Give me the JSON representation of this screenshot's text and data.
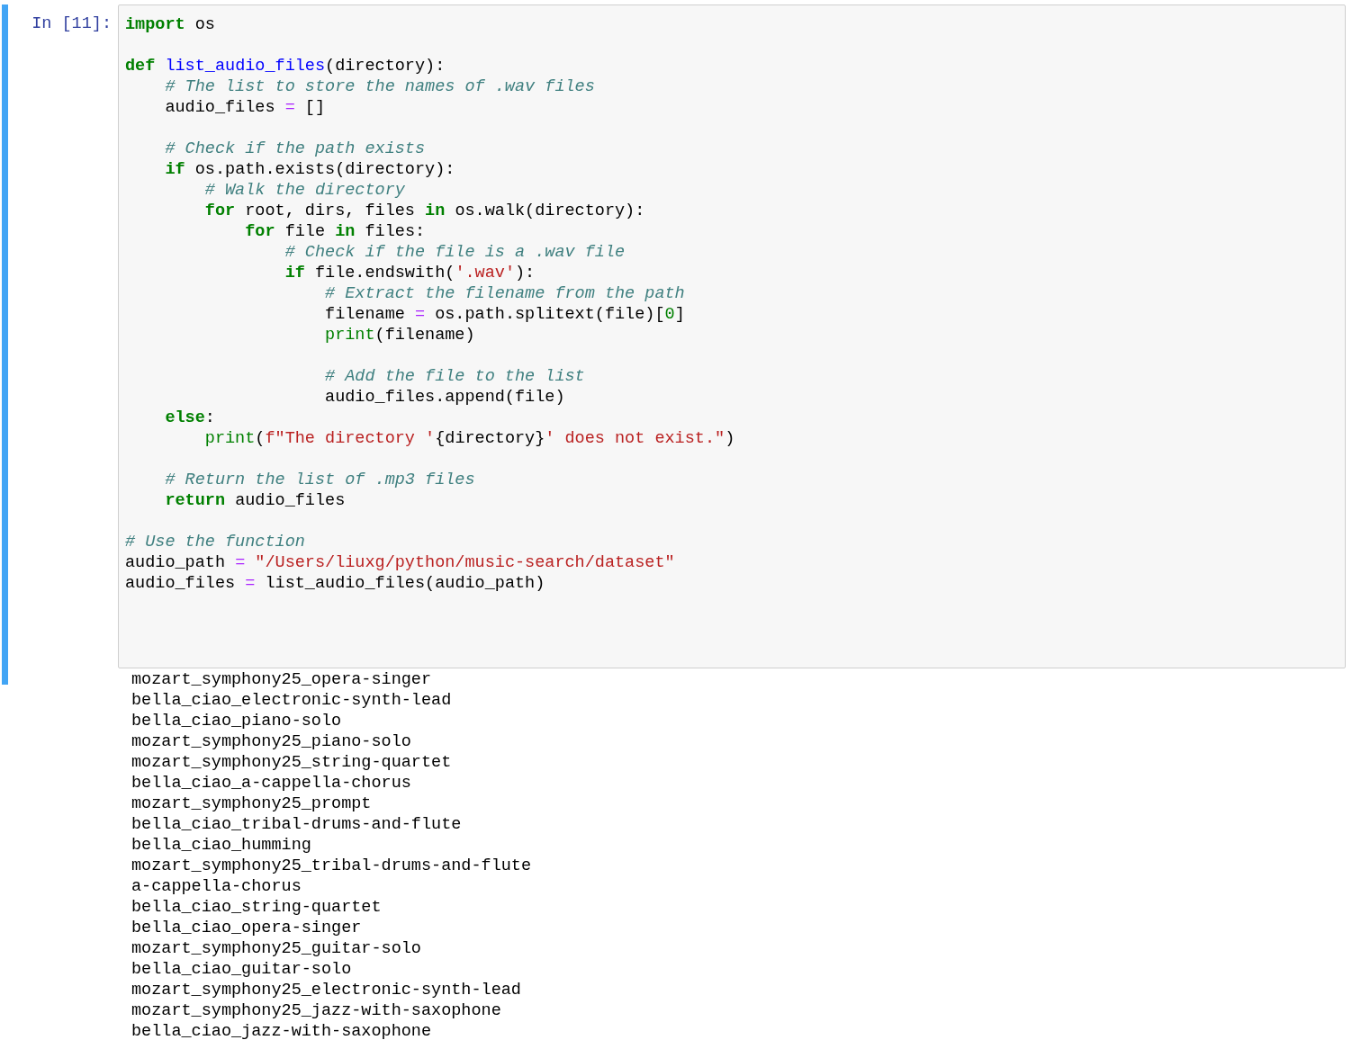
{
  "cell": {
    "prompt": "In [11]:",
    "selected": true,
    "lines": [
      {
        "kind": "code",
        "tokens": [
          {
            "kind": "keyword",
            "text": "import"
          },
          {
            "kind": "plain",
            "text": " os"
          }
        ]
      },
      {
        "kind": "blank"
      },
      {
        "kind": "code",
        "tokens": [
          {
            "kind": "keyword",
            "text": "def"
          },
          {
            "kind": "name",
            "text": " list_audio_files"
          },
          {
            "kind": "plain",
            "text": "(directory):"
          }
        ]
      },
      {
        "kind": "code",
        "tokens": [
          {
            "kind": "comment",
            "text": "    # The list to store the names of .wav files"
          }
        ]
      },
      {
        "kind": "code",
        "tokens": [
          {
            "kind": "plain",
            "text": "    audio_files "
          },
          {
            "kind": "operator",
            "text": "="
          },
          {
            "kind": "plain",
            "text": " []"
          }
        ]
      },
      {
        "kind": "blank"
      },
      {
        "kind": "code",
        "tokens": [
          {
            "kind": "comment",
            "text": "    # Check if the path exists"
          }
        ]
      },
      {
        "kind": "code",
        "tokens": [
          {
            "kind": "keyword",
            "text": "    if"
          },
          {
            "kind": "plain",
            "text": " os.path.exists(directory):"
          }
        ]
      },
      {
        "kind": "code",
        "tokens": [
          {
            "kind": "comment",
            "text": "        # Walk the directory"
          }
        ]
      },
      {
        "kind": "code",
        "tokens": [
          {
            "kind": "keyword",
            "text": "        for"
          },
          {
            "kind": "plain",
            "text": " root, dirs, files "
          },
          {
            "kind": "keyword",
            "text": "in"
          },
          {
            "kind": "plain",
            "text": " os.walk(directory):"
          }
        ]
      },
      {
        "kind": "code",
        "tokens": [
          {
            "kind": "keyword",
            "text": "            for"
          },
          {
            "kind": "plain",
            "text": " file "
          },
          {
            "kind": "keyword",
            "text": "in"
          },
          {
            "kind": "plain",
            "text": " files:"
          }
        ]
      },
      {
        "kind": "code",
        "tokens": [
          {
            "kind": "comment",
            "text": "                # Check if the file is a .wav file"
          }
        ]
      },
      {
        "kind": "code",
        "tokens": [
          {
            "kind": "keyword",
            "text": "                if"
          },
          {
            "kind": "plain",
            "text": " file.endswith("
          },
          {
            "kind": "string",
            "text": "'.wav'"
          },
          {
            "kind": "plain",
            "text": "):"
          }
        ]
      },
      {
        "kind": "code",
        "tokens": [
          {
            "kind": "comment",
            "text": "                    # Extract the filename from the path"
          }
        ]
      },
      {
        "kind": "code",
        "tokens": [
          {
            "kind": "plain",
            "text": "                    filename "
          },
          {
            "kind": "operator",
            "text": "="
          },
          {
            "kind": "plain",
            "text": " os.path.splitext(file)["
          },
          {
            "kind": "number",
            "text": "0"
          },
          {
            "kind": "plain",
            "text": "]"
          }
        ]
      },
      {
        "kind": "code",
        "tokens": [
          {
            "kind": "builtin",
            "text": "                    print"
          },
          {
            "kind": "plain",
            "text": "(filename)"
          }
        ]
      },
      {
        "kind": "blank"
      },
      {
        "kind": "code",
        "tokens": [
          {
            "kind": "comment",
            "text": "                    # Add the file to the list"
          }
        ]
      },
      {
        "kind": "code",
        "tokens": [
          {
            "kind": "plain",
            "text": "                    audio_files.append(file)"
          }
        ]
      },
      {
        "kind": "code",
        "tokens": [
          {
            "kind": "keyword",
            "text": "    else"
          },
          {
            "kind": "plain",
            "text": ":"
          }
        ]
      },
      {
        "kind": "code",
        "tokens": [
          {
            "kind": "builtin",
            "text": "        print"
          },
          {
            "kind": "plain",
            "text": "("
          },
          {
            "kind": "string",
            "text": "f\"The directory '"
          },
          {
            "kind": "plain",
            "text": "{directory}"
          },
          {
            "kind": "string",
            "text": "' does not exist.\""
          },
          {
            "kind": "plain",
            "text": ")"
          }
        ]
      },
      {
        "kind": "blank"
      },
      {
        "kind": "code",
        "tokens": [
          {
            "kind": "comment",
            "text": "    # Return the list of .mp3 files"
          }
        ]
      },
      {
        "kind": "code",
        "tokens": [
          {
            "kind": "keyword",
            "text": "    return"
          },
          {
            "kind": "plain",
            "text": " audio_files"
          }
        ]
      },
      {
        "kind": "blank"
      },
      {
        "kind": "code",
        "tokens": [
          {
            "kind": "comment",
            "text": "# Use the function"
          }
        ]
      },
      {
        "kind": "code",
        "tokens": [
          {
            "kind": "plain",
            "text": "audio_path "
          },
          {
            "kind": "operator",
            "text": "="
          },
          {
            "kind": "string",
            "text": " \"/Users/liuxg/python/music-search/dataset\""
          }
        ]
      },
      {
        "kind": "code",
        "tokens": [
          {
            "kind": "plain",
            "text": "audio_files "
          },
          {
            "kind": "operator",
            "text": "="
          },
          {
            "kind": "plain",
            "text": " list_audio_files(audio_path)"
          }
        ]
      }
    ]
  },
  "output": {
    "lines": [
      "mozart_symphony25_opera-singer",
      "bella_ciao_electronic-synth-lead",
      "bella_ciao_piano-solo",
      "mozart_symphony25_piano-solo",
      "mozart_symphony25_string-quartet",
      "bella_ciao_a-cappella-chorus",
      "mozart_symphony25_prompt",
      "bella_ciao_tribal-drums-and-flute",
      "bella_ciao_humming",
      "mozart_symphony25_tribal-drums-and-flute",
      "a-cappella-chorus",
      "bella_ciao_string-quartet",
      "bella_ciao_opera-singer",
      "mozart_symphony25_guitar-solo",
      "bella_ciao_guitar-solo",
      "mozart_symphony25_electronic-synth-lead",
      "mozart_symphony25_jazz-with-saxophone",
      "bella_ciao_jazz-with-saxophone"
    ]
  }
}
